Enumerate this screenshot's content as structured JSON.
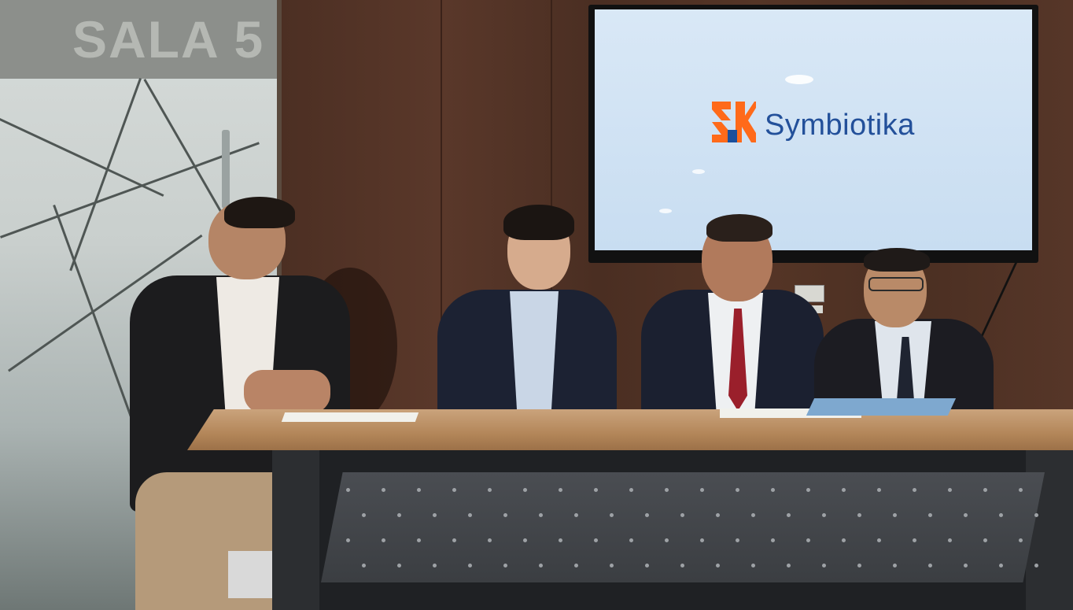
{
  "scene": {
    "room_sign": "SALA 5",
    "screen_brand": "Symbiotika",
    "logo_icon": "sk-logo-icon",
    "colors": {
      "logo_orange": "#ff6a1a",
      "logo_blue": "#1a4f9c",
      "brand_text": "#23509a",
      "screen_bg": "#d3e4f4",
      "wood": "#4f3226",
      "desk_top": "#b98d61",
      "desk_panel": "#3f4246"
    }
  },
  "people": [
    {
      "position": "far-left",
      "tie": false
    },
    {
      "position": "center-left",
      "tie": false
    },
    {
      "position": "center-right",
      "tie": true,
      "tie_color": "#9a1f2b"
    },
    {
      "position": "far-right",
      "tie": true,
      "tie_color": "#1f2431"
    }
  ]
}
